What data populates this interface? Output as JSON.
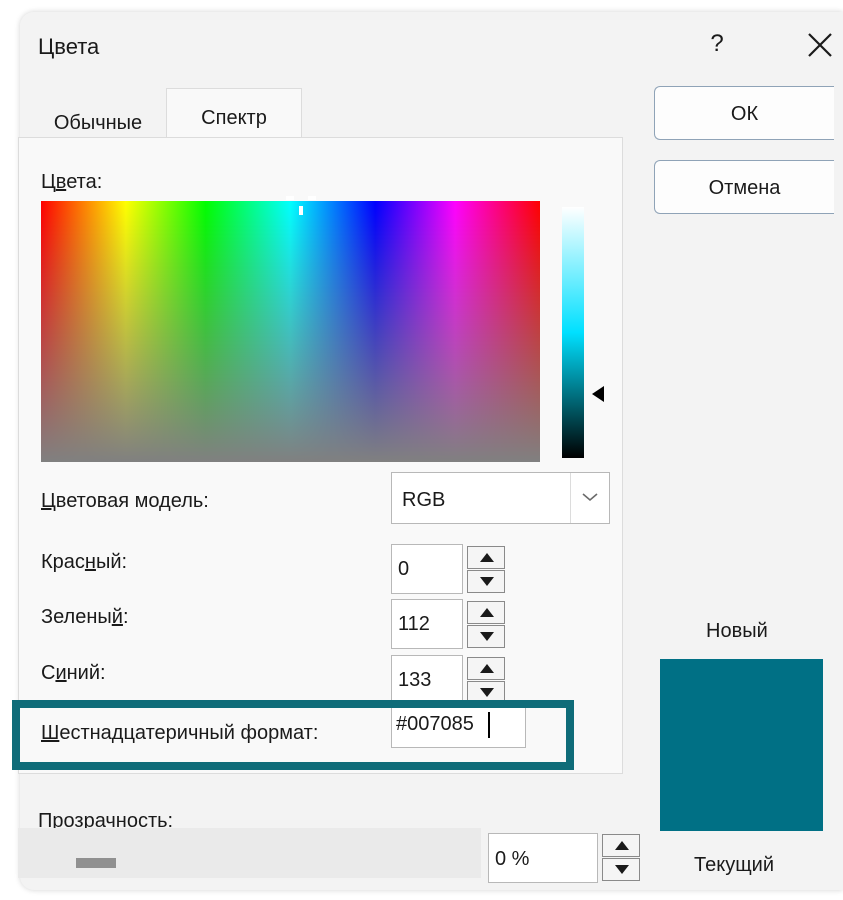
{
  "window": {
    "title": "Цвета",
    "help_label": "?",
    "close_icon": "close-icon"
  },
  "tabs": [
    {
      "label": "Обычные",
      "active": false
    },
    {
      "label": "Спектр",
      "active": true
    }
  ],
  "colors_label": {
    "prefix": "Ц",
    "underlined": "в",
    "rest": "ета:"
  },
  "color_model": {
    "label_underlined": "Ц",
    "label_rest": "ветовая модель:",
    "value": "RGB"
  },
  "red": {
    "label_pre": "Крас",
    "label_u": "н",
    "label_post": "ый:",
    "value": "0"
  },
  "green": {
    "label_pre": "Зелены",
    "label_u": "й",
    "label_post": ":",
    "value": "112"
  },
  "blue": {
    "label_pre": "С",
    "label_u": "и",
    "label_post": "ний:",
    "value": "133"
  },
  "hex": {
    "label_u": "Ш",
    "label_rest": "естнадцатеричный формат:",
    "value": "#007085"
  },
  "transparency": {
    "label_pre": "Про",
    "label_u": "з",
    "label_post": "рачность:",
    "value": "0 %",
    "level_percent": 0
  },
  "buttons": {
    "ok": "ОК",
    "cancel": "Отмена"
  },
  "preview": {
    "new_label": "Новый",
    "current_label": "Текущий",
    "new_color": "#007085"
  },
  "colors": {
    "highlight_border": "#0f6c79",
    "accent": "#007085"
  }
}
